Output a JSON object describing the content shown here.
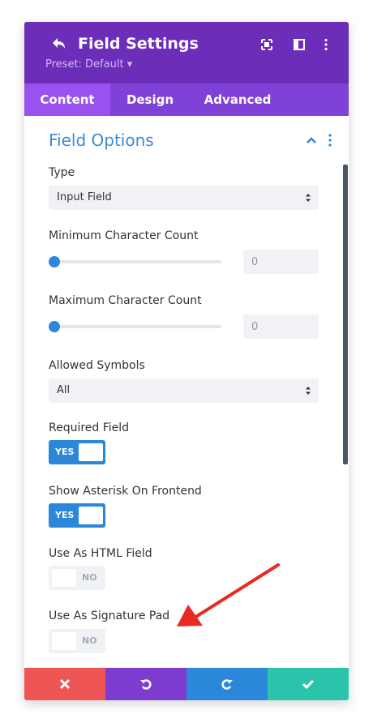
{
  "header": {
    "title": "Field Settings",
    "preset": "Preset: Default ▾"
  },
  "tabs": [
    {
      "label": "Content",
      "active": true
    },
    {
      "label": "Design",
      "active": false
    },
    {
      "label": "Advanced",
      "active": false
    }
  ],
  "section": {
    "title": "Field Options"
  },
  "fields": {
    "type": {
      "label": "Type",
      "value": "Input Field"
    },
    "min_count": {
      "label": "Minimum Character Count",
      "value": "0"
    },
    "max_count": {
      "label": "Maximum Character Count",
      "value": "0"
    },
    "allowed_symbols": {
      "label": "Allowed Symbols",
      "value": "All"
    },
    "required": {
      "label": "Required Field",
      "state": "YES"
    },
    "asterisk": {
      "label": "Show Asterisk On Frontend",
      "state": "YES"
    },
    "html_field": {
      "label": "Use As HTML Field",
      "state": "NO"
    },
    "signature_pad": {
      "label": "Use As Signature Pad",
      "state": "NO"
    }
  },
  "colors": {
    "header": "#6c2eb9",
    "tabs": "#8041d7",
    "active_tab": "#9951ef",
    "accent_blue": "#2b87da",
    "cancel": "#ef5555",
    "undo": "#7e3bd0",
    "redo": "#2b87da",
    "save": "#29c4a9",
    "annotation_arrow": "#e82a22"
  },
  "icons": {
    "back": "undo-arrow-icon",
    "header_right": [
      "fullscreen-icon",
      "split-view-icon",
      "kebab-menu-icon"
    ],
    "section": [
      "chevron-up-icon",
      "kebab-menu-icon"
    ],
    "footer": [
      "close-icon",
      "undo-icon",
      "redo-icon",
      "check-icon"
    ]
  }
}
